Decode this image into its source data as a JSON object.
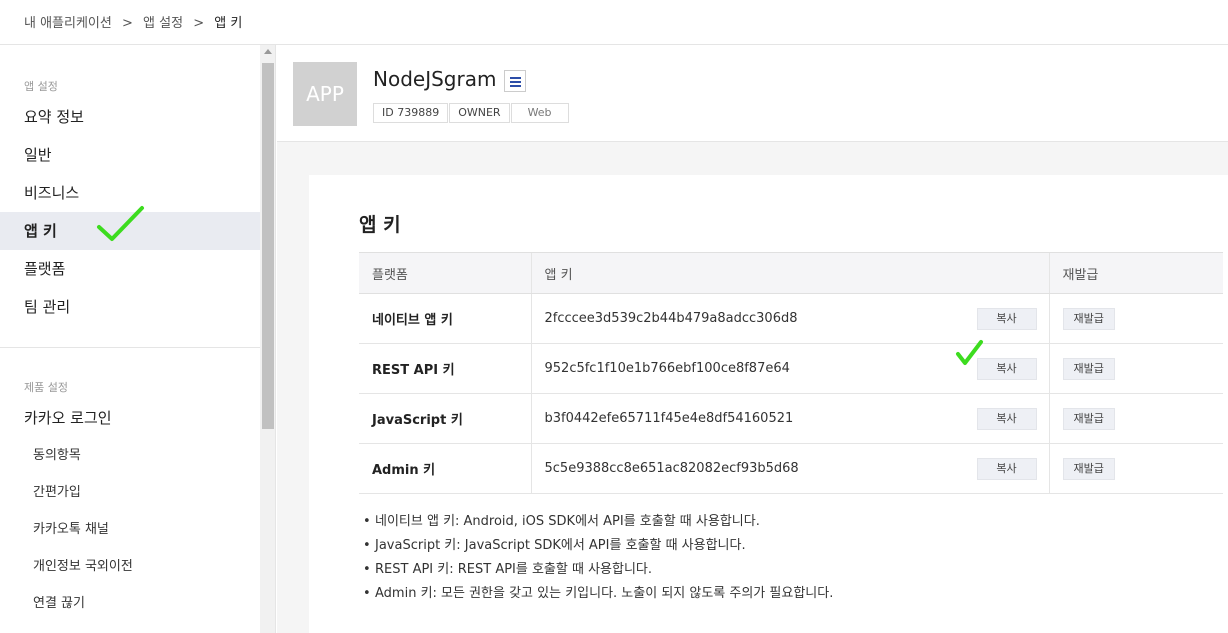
{
  "breadcrumb": [
    "내 애플리케이션",
    ">",
    "앱 설정",
    ">",
    "앱 키"
  ],
  "sidebar": {
    "section1_title": "앱 설정",
    "section1_items": [
      "요약 정보",
      "일반",
      "비즈니스",
      "앱 키",
      "플랫폼",
      "팀 관리"
    ],
    "active_item": "앱 키",
    "section2_title": "제품 설정",
    "section2_item": "카카오 로그인",
    "section2_subitems": [
      "동의항목",
      "간편가입",
      "카카오톡 채널",
      "개인정보 국외이전",
      "연결 끊기"
    ]
  },
  "app": {
    "logo_text": "APP",
    "name": "NodeJSgram",
    "tags": [
      "ID 739889",
      "OWNER",
      "Web"
    ]
  },
  "card": {
    "title": "앱 키",
    "headers": [
      "플랫폼",
      "앱 키",
      "재발급"
    ],
    "rows": [
      {
        "platform": "네이티브 앱 키",
        "key": "2fcccee3d539c2b44b479a8adcc306d8"
      },
      {
        "platform": "REST API 키",
        "key": "952c5fc1f10e1b766ebf100ce8f87e64"
      },
      {
        "platform": "JavaScript 키",
        "key": "b3f0442efe65711f45e4e8df54160521"
      },
      {
        "platform": "Admin 키",
        "key": "5c5e9388cc8e651ac82082ecf93b5d68"
      }
    ],
    "copy_label": "복사",
    "reissue_label": "재발급",
    "notes": [
      "네이티브 앱 키: Android, iOS SDK에서 API를 호출할 때 사용합니다.",
      "JavaScript 키: JavaScript SDK에서 API를 호출할 때 사용합니다.",
      "REST API 키: REST API를 호출할 때 사용합니다.",
      "Admin 키: 모든 권한을 갖고 있는 키입니다. 노출이 되지 않도록 주의가 필요합니다."
    ]
  },
  "colors": {
    "checkmark": "#3ddc1f",
    "accent": "#2d4ea8",
    "active_bg": "#e9ebf1"
  }
}
